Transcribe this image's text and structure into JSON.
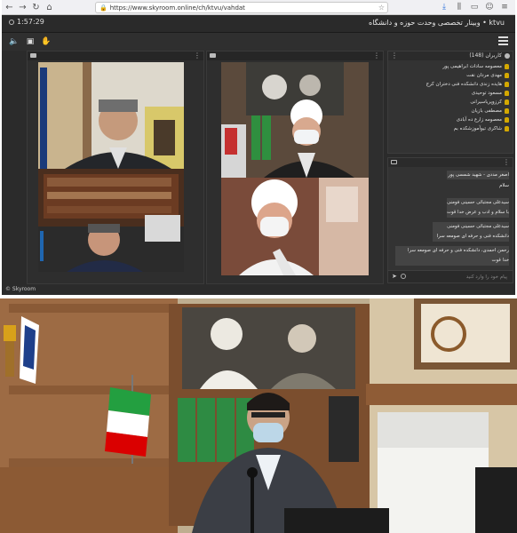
{
  "browser": {
    "url": "https://www.skyroom.online/ch/ktvu/vahdat",
    "nav": [
      "←",
      "→",
      "↻",
      "⌂"
    ],
    "toolbar_icons": [
      "download-icon",
      "library-icon",
      "reader-icon",
      "sync-icon",
      "menu-icon"
    ]
  },
  "app": {
    "timer": "1:57:29",
    "title": "ktvu • وبینار تخصصی وحدت حوزه و دانشگاه",
    "logo": "Skyroom"
  },
  "users": {
    "title": "کاربران (148)",
    "list": [
      "معصومه سادات ابراهیمی پور",
      "مهدی مردان نقت",
      "هایده زندی دانشکده فنی دختران کرج",
      "مسعود توحیدی",
      "کرزوپریاسیرانی",
      "مصطفی بازیان",
      "معصومه زارع ده آبادی",
      "شاکری تیوآموزشکده بم"
    ]
  },
  "chat": {
    "messages": [
      "اصغر مددی - شهید شمسی پور",
      "سلام",
      "سیدعلی مجتبائی حسینی فومنی",
      "با سلام و ادب و عرض خدا قوت",
      "سیدعلی مجتبائی حسینی فومنی",
      "دانشکده فنی و حرفه ای صومعه سرا",
      "رحمن احمدی، دانشکده فنی و حرفه ای صومعه سرا",
      "خدا قوت"
    ],
    "placeholder": "پیام خود را وارد کنید"
  },
  "colors": {
    "panel": "#2e2e2e",
    "user_icon": "#d4a800",
    "download": "#2a6fdb"
  }
}
